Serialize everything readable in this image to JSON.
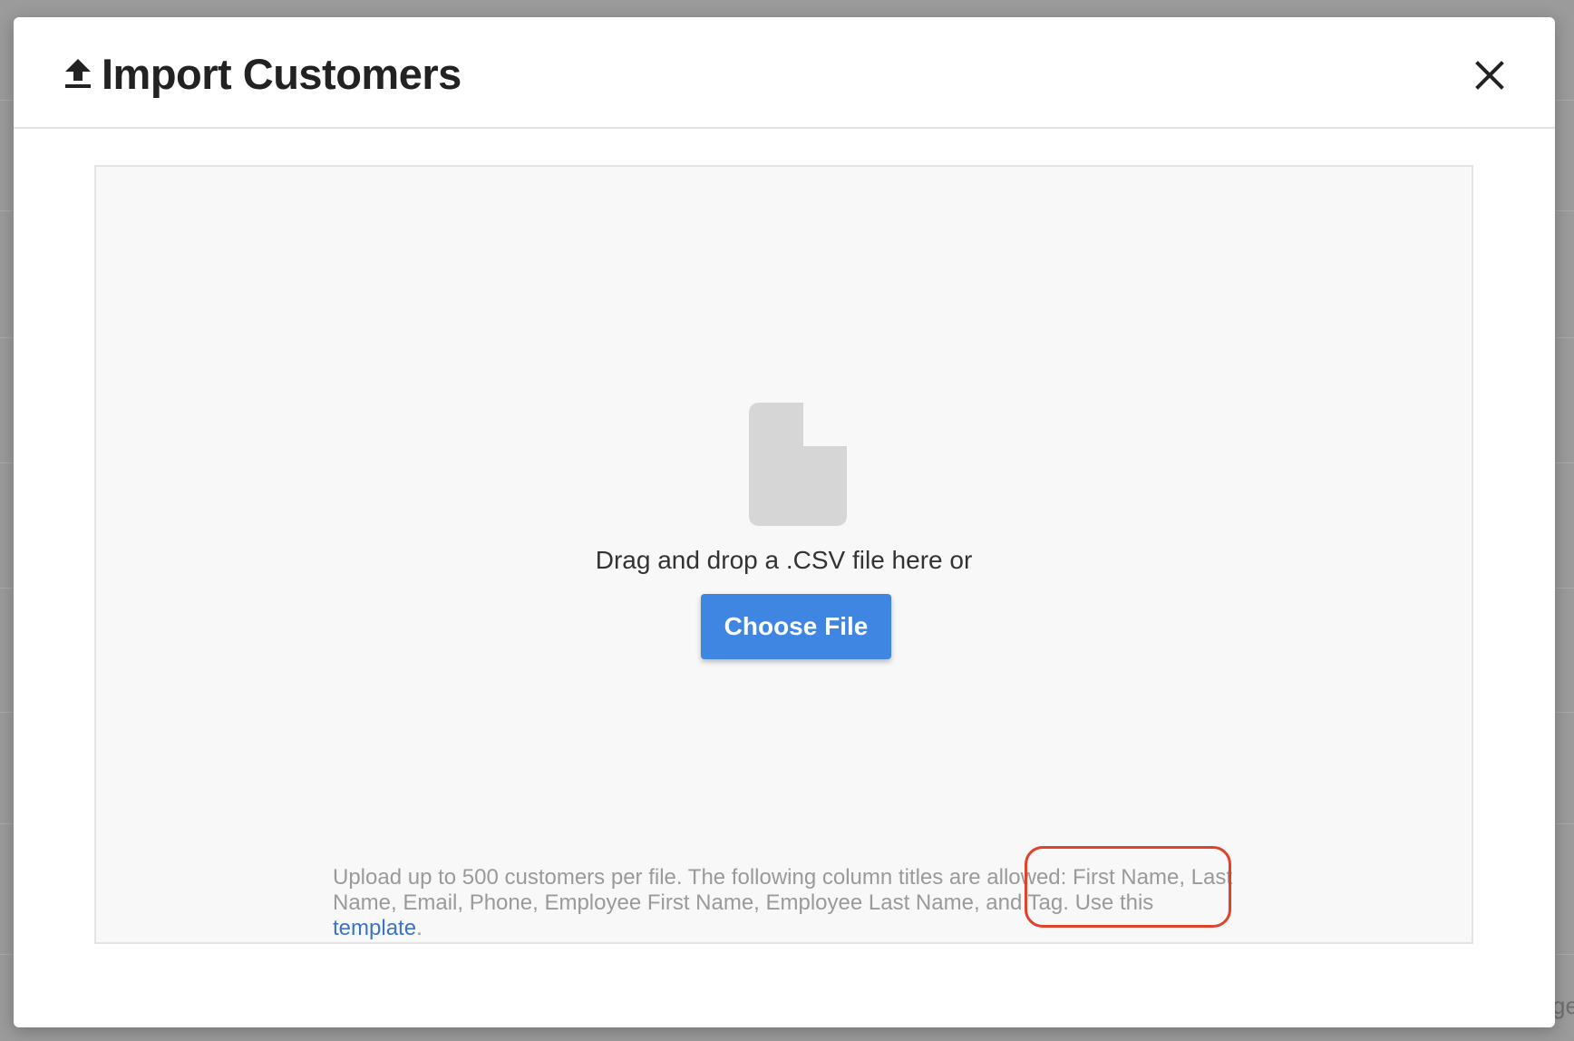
{
  "modal": {
    "title": "Import Customers",
    "icons": {
      "upload": "upload-arrow-icon",
      "close": "close-x-icon",
      "file": "file-document-icon"
    }
  },
  "drop_zone": {
    "drag_text": "Drag and drop a .CSV file here or",
    "choose_button_label": "Choose File",
    "info_text_before_link": "Upload up to 500 customers per file. The following column titles are allowed: First Name, Last Name, Email, Phone, Employee First Name, Employee Last Name, and Tag. Use this ",
    "template_link_label": "template",
    "info_text_after_link": "."
  },
  "background": {
    "partial_text": "ge"
  },
  "colors": {
    "primary_button": "#3f86e2",
    "link": "#3a73c9",
    "annotation_circle": "#e0422b"
  }
}
